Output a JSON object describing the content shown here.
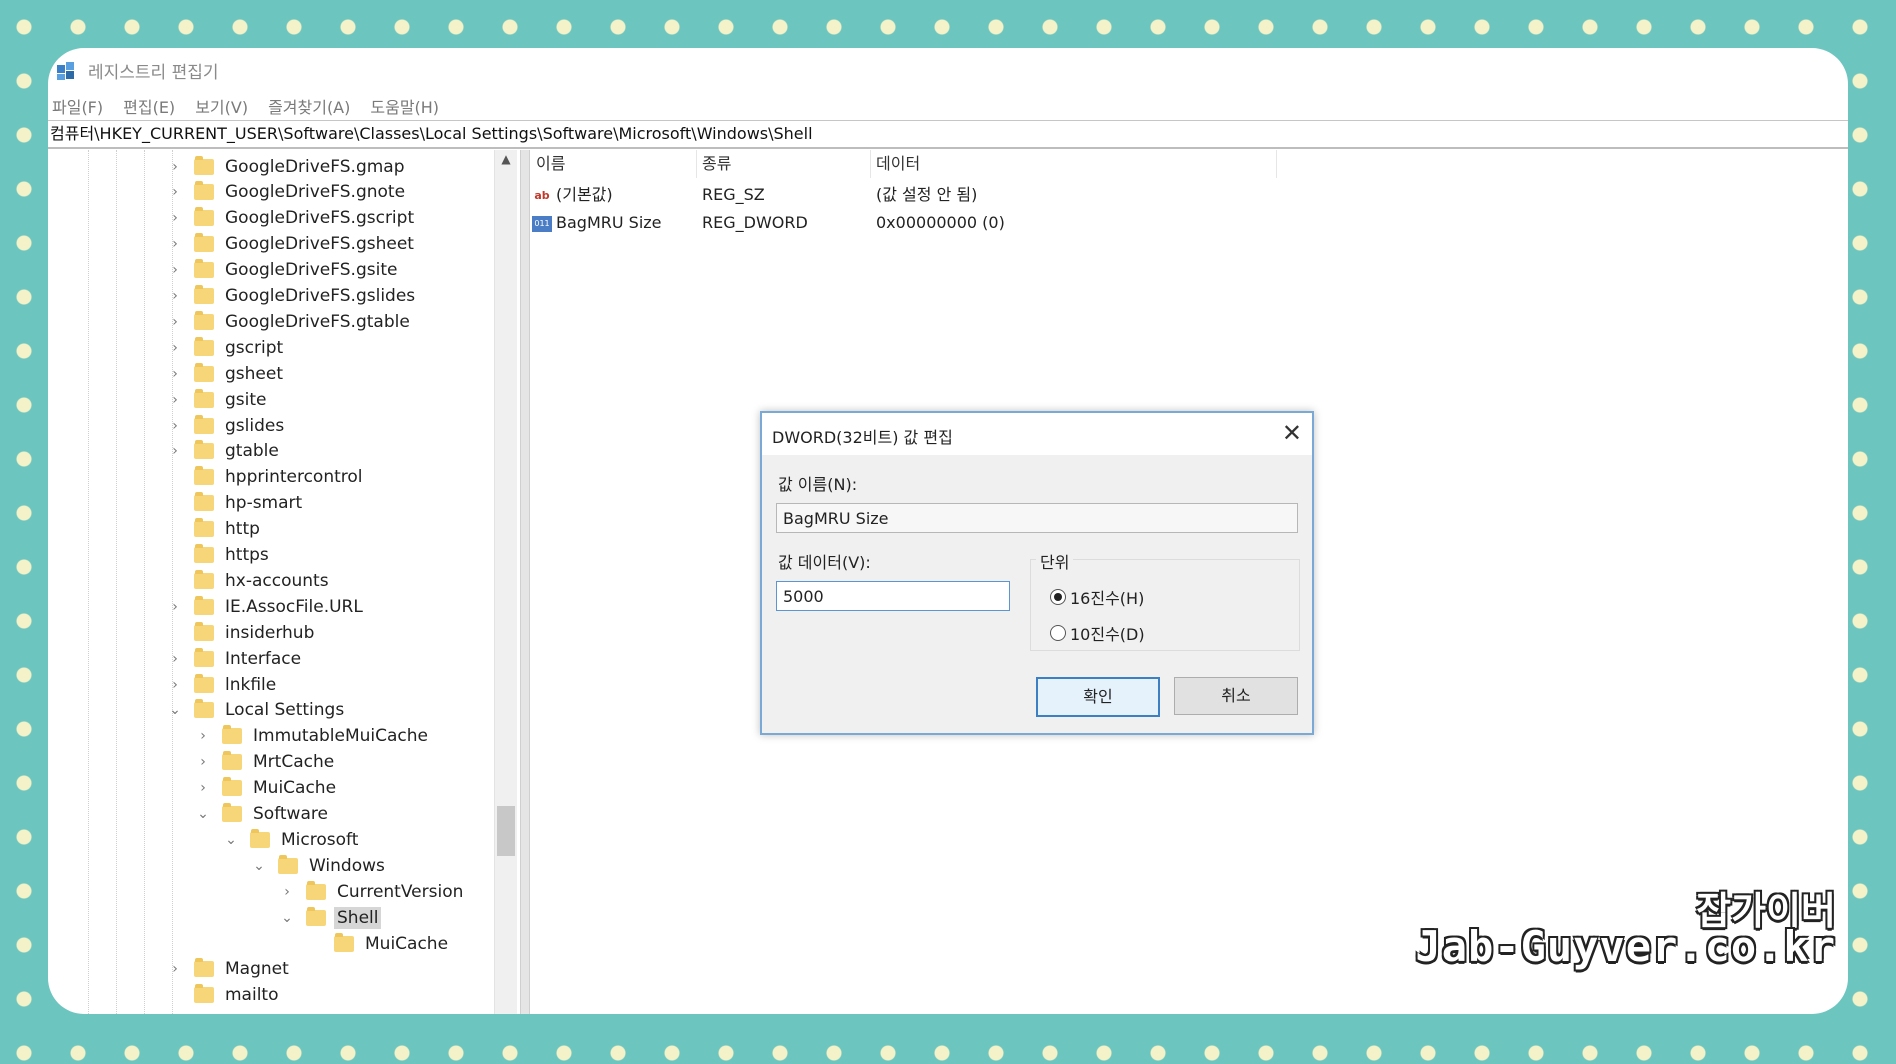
{
  "window": {
    "title": "레지스트리 편집기"
  },
  "menu": [
    "파일(F)",
    "편집(E)",
    "보기(V)",
    "즐겨찾기(A)",
    "도움말(H)"
  ],
  "address": "컴퓨터\\HKEY_CURRENT_USER\\Software\\Classes\\Local Settings\\Software\\Microsoft\\Windows\\Shell",
  "tree": [
    {
      "label": "GoogleDriveFS.gmap",
      "expander": "›"
    },
    {
      "label": "GoogleDriveFS.gnote",
      "expander": "›"
    },
    {
      "label": "GoogleDriveFS.gscript",
      "expander": "›"
    },
    {
      "label": "GoogleDriveFS.gsheet",
      "expander": "›"
    },
    {
      "label": "GoogleDriveFS.gsite",
      "expander": "›"
    },
    {
      "label": "GoogleDriveFS.gslides",
      "expander": "›"
    },
    {
      "label": "GoogleDriveFS.gtable",
      "expander": "›"
    },
    {
      "label": "gscript",
      "expander": "›"
    },
    {
      "label": "gsheet",
      "expander": "›"
    },
    {
      "label": "gsite",
      "expander": "›"
    },
    {
      "label": "gslides",
      "expander": "›"
    },
    {
      "label": "gtable",
      "expander": "›"
    },
    {
      "label": "hpprintercontrol",
      "expander": ""
    },
    {
      "label": "hp-smart",
      "expander": ""
    },
    {
      "label": "http",
      "expander": ""
    },
    {
      "label": "https",
      "expander": ""
    },
    {
      "label": "hx-accounts",
      "expander": ""
    },
    {
      "label": "IE.AssocFile.URL",
      "expander": "›"
    },
    {
      "label": "insiderhub",
      "expander": ""
    },
    {
      "label": "Interface",
      "expander": "›"
    },
    {
      "label": "lnkfile",
      "expander": "›"
    },
    {
      "label": "Local Settings",
      "expander": "⌄"
    },
    {
      "label": "ImmutableMuiCache",
      "expander": "›"
    },
    {
      "label": "MrtCache",
      "expander": "›"
    },
    {
      "label": "MuiCache",
      "expander": "›"
    },
    {
      "label": "Software",
      "expander": "⌄"
    },
    {
      "label": "Microsoft",
      "expander": "⌄"
    },
    {
      "label": "Windows",
      "expander": "⌄"
    },
    {
      "label": "CurrentVersion",
      "expander": "›"
    },
    {
      "label": "Shell",
      "expander": "⌄"
    },
    {
      "label": "MuiCache",
      "expander": ""
    },
    {
      "label": "Magnet",
      "expander": "›"
    },
    {
      "label": "mailto",
      "expander": ""
    }
  ],
  "list": {
    "columns": [
      "이름",
      "종류",
      "데이터"
    ],
    "rows": [
      {
        "icon": "string-value-icon",
        "name": "(기본값)",
        "type": "REG_SZ",
        "data": "(값 설정 안 됨)"
      },
      {
        "icon": "dword-value-icon",
        "name": "BagMRU Size",
        "type": "REG_DWORD",
        "data": "0x00000000 (0)"
      }
    ]
  },
  "dialog": {
    "title": "DWORD(32비트) 값 편집",
    "name_label": "값 이름(N):",
    "name_value": "BagMRU Size",
    "data_label": "값 데이터(V):",
    "data_value": "5000",
    "base_label": "단위",
    "base_hex": "16진수(H)",
    "base_dec": "10진수(D)",
    "selected_base": "hex",
    "ok": "확인",
    "cancel": "취소"
  },
  "watermark": {
    "line1": "잡가이버",
    "line2": "Jab-Guyver.co.kr"
  }
}
